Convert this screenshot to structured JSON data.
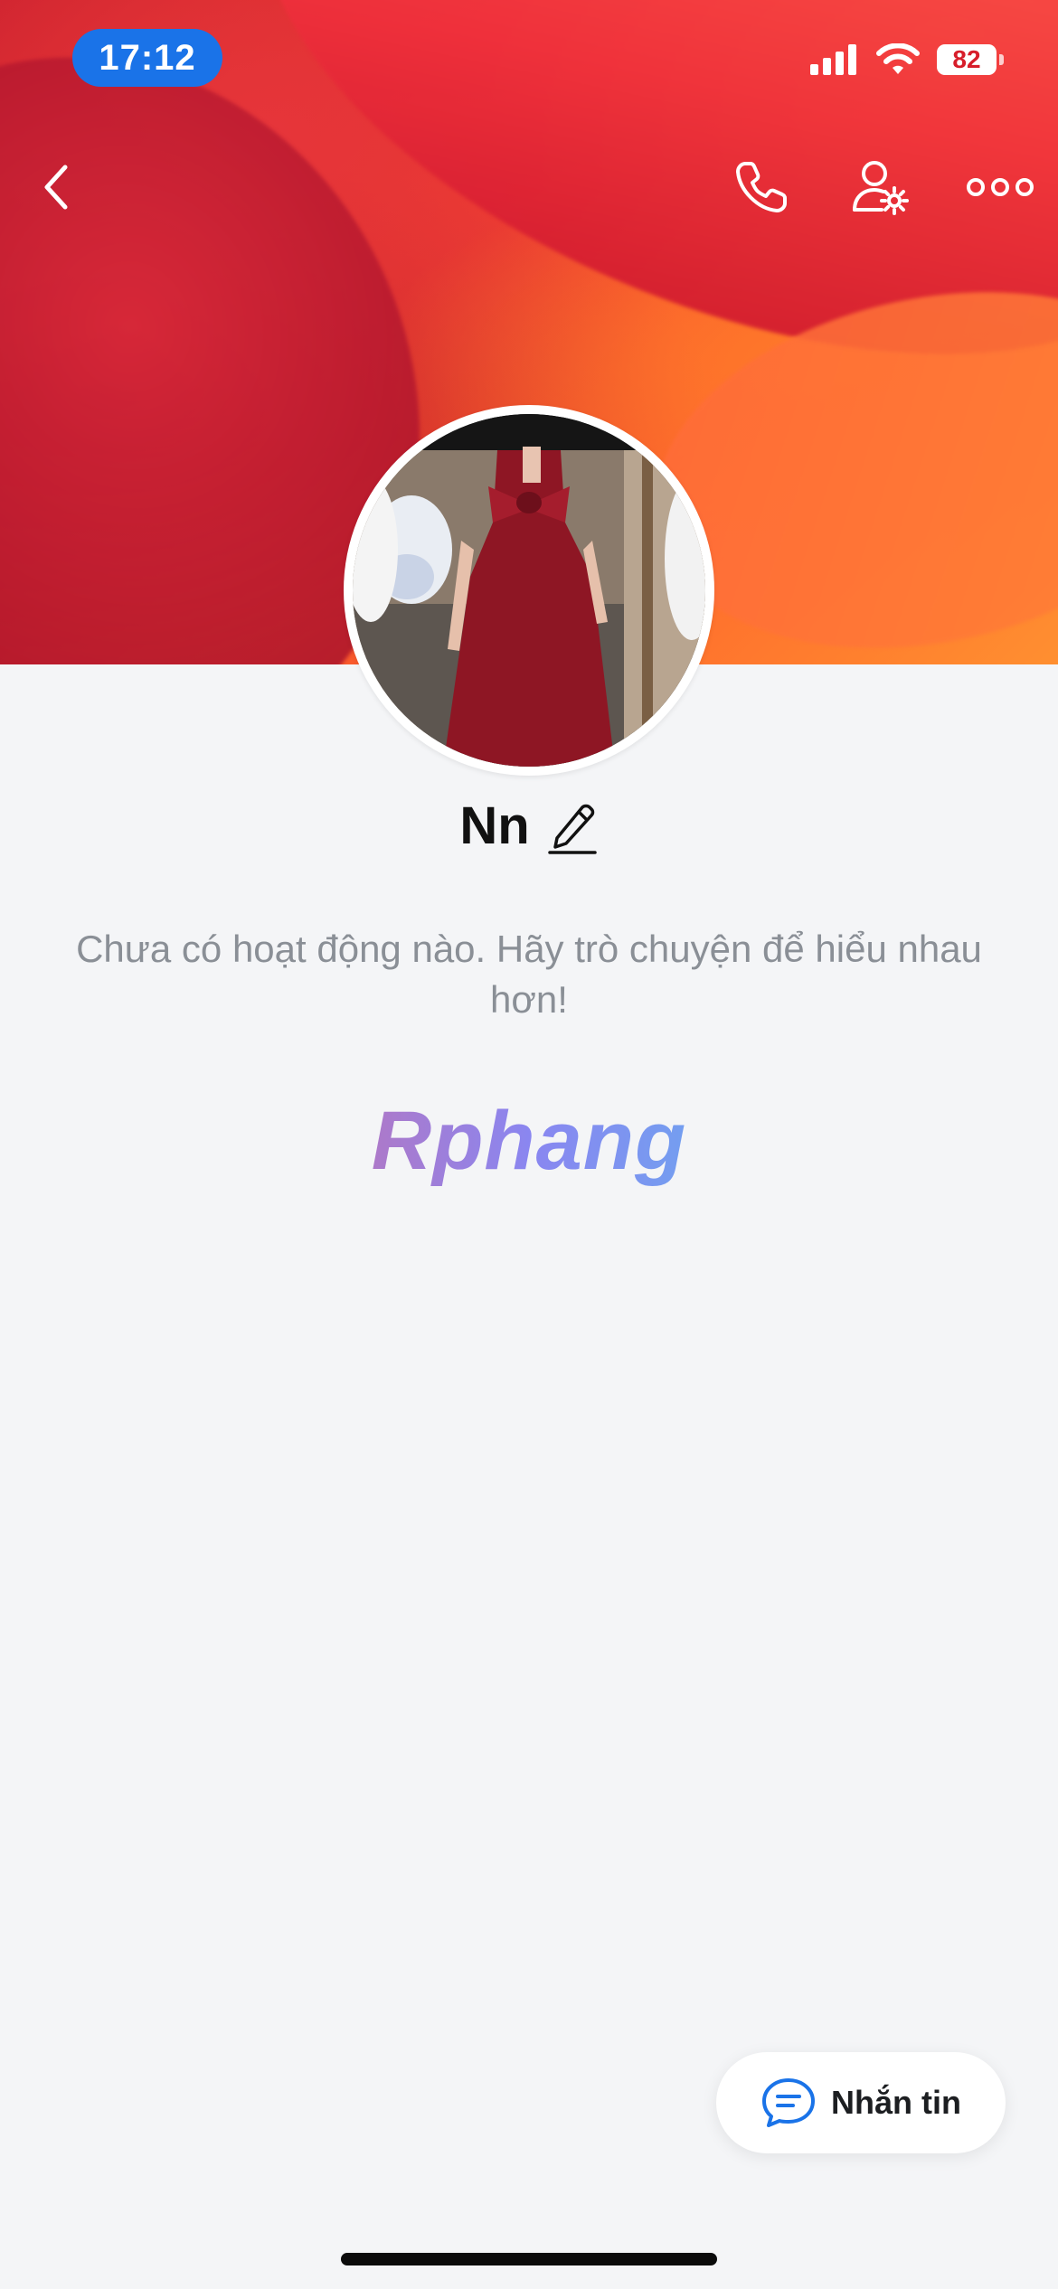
{
  "status_bar": {
    "time": "17:12",
    "battery": "82"
  },
  "header": {
    "back_icon": "chevron-left-icon",
    "actions": [
      {
        "name": "call",
        "icon": "phone-icon"
      },
      {
        "name": "profile-settings",
        "icon": "user-settings-icon"
      },
      {
        "name": "more",
        "icon": "more-horizontal-icon"
      }
    ]
  },
  "profile": {
    "name": "Nn",
    "edit_icon": "pencil-icon",
    "empty_message": "Chưa có hoạt động nào. Hãy trò chuyện để hiểu nhau hơn!"
  },
  "watermark": "Rphang",
  "message_button": {
    "label": "Nhắn tin",
    "icon": "chat-bubble-icon"
  },
  "colors": {
    "accent": "#1a73e8",
    "background": "#f4f5f7"
  }
}
